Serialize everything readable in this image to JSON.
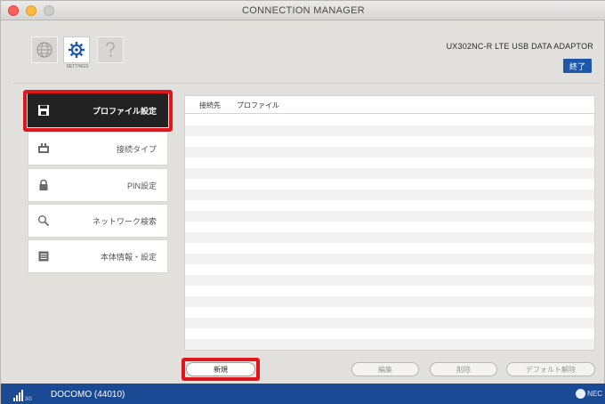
{
  "window": {
    "title": "CONNECTION MANAGER"
  },
  "toolbar": {
    "gear_caption": "SETTINGS",
    "device_name": "UX302NC-R LTE USB DATA ADAPTOR",
    "exit_label": "終了"
  },
  "sidebar": {
    "items": [
      {
        "label": "プロファイル設定",
        "icon": "save-icon",
        "active": true
      },
      {
        "label": "接続タイプ",
        "icon": "connection-type-icon",
        "active": false
      },
      {
        "label": "PIN設定",
        "icon": "lock-icon",
        "active": false
      },
      {
        "label": "ネットワーク検索",
        "icon": "search-icon",
        "active": false
      },
      {
        "label": "本体情報・設定",
        "icon": "info-list-icon",
        "active": false
      }
    ]
  },
  "profile_table": {
    "columns": [
      "接続先",
      "プロファイル"
    ],
    "rows": []
  },
  "buttons": {
    "new_label": "新規",
    "edit_label": "編集",
    "delete_label": "削除",
    "default_clear_label": "デフォルト解除"
  },
  "status": {
    "network_type": "3G",
    "carrier": "DOCOMO (44010)",
    "brand": "NEC"
  },
  "colors": {
    "highlight": "#e0161d",
    "status_bar": "#1a4a93",
    "active_menu": "#222222",
    "exit_button": "#1f57a8"
  }
}
